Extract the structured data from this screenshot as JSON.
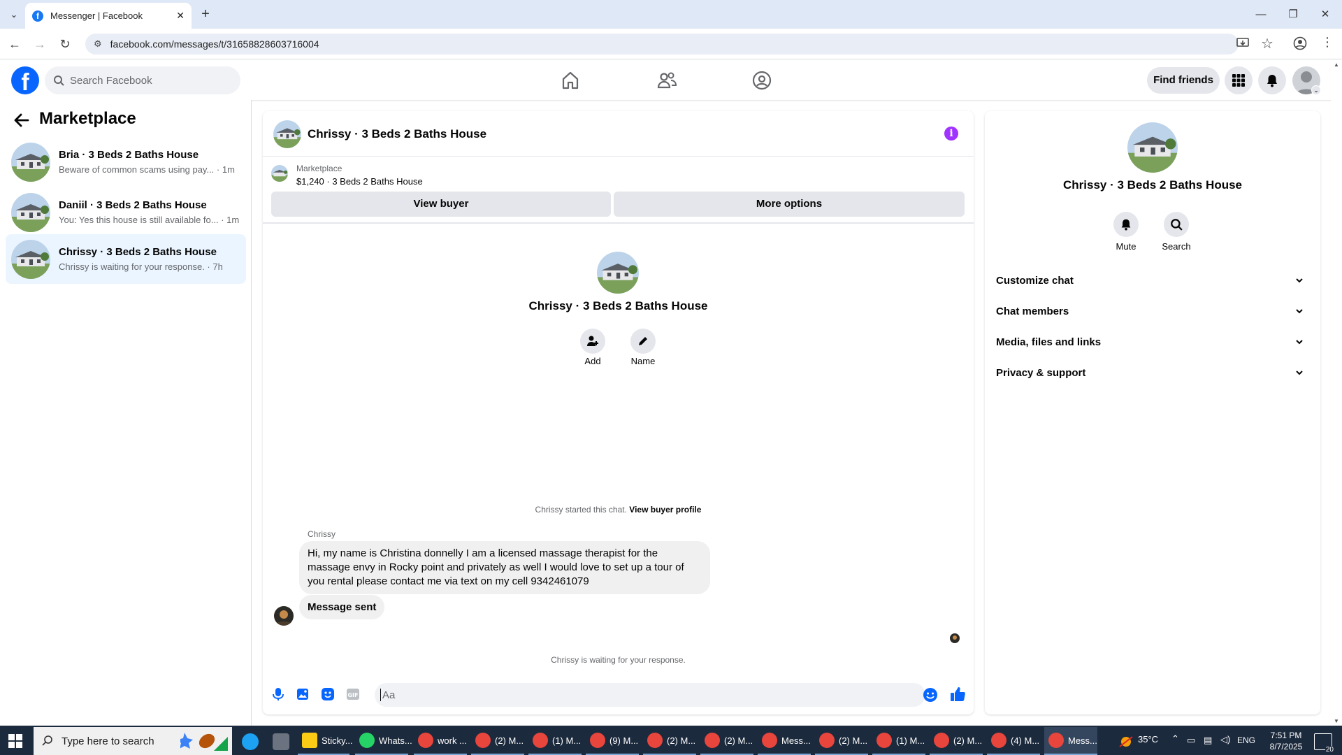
{
  "browser": {
    "tab_title": "Messenger | Facebook",
    "url": "facebook.com/messages/t/31658828603716004"
  },
  "header": {
    "search_placeholder": "Search Facebook",
    "find_friends": "Find friends"
  },
  "sidebar": {
    "title": "Marketplace",
    "conversations": [
      {
        "name": "Bria · 3 Beds 2 Baths House",
        "preview": "Beware of common scams using pay... · 1m",
        "active": false
      },
      {
        "name": "Daniil · 3 Beds 2 Baths House",
        "preview": "You: Yes this house is still available fo... · 1m",
        "active": false
      },
      {
        "name": "Chrissy · 3 Beds 2 Baths House",
        "preview": "Chrissy is waiting for your response. · 7h",
        "active": true
      }
    ]
  },
  "chat": {
    "title": "Chrissy · 3 Beds 2 Baths House",
    "marketplace_label": "Marketplace",
    "listing": "$1,240 · 3 Beds 2 Baths House",
    "view_buyer": "View buyer",
    "more_options": "More options",
    "center_name": "Chrissy · 3 Beds 2 Baths House",
    "add_label": "Add",
    "name_label": "Name",
    "started_text": "Chrissy started this chat.",
    "view_buyer_profile": "View buyer profile",
    "sender": "Chrissy",
    "message1": "Hi, my name is Christina donnelly I am a licensed massage therapist for the massage envy in Rocky point and privately as well I would love to set up a tour of you rental please contact me via text on my cell 9342461079",
    "message2": "Message sent",
    "waiting": "Chrissy is waiting for your response.",
    "input_placeholder": "Aa"
  },
  "details": {
    "name": "Chrissy · 3 Beds 2 Baths House",
    "mute": "Mute",
    "search": "Search",
    "sections": [
      "Customize chat",
      "Chat members",
      "Media, files and links",
      "Privacy & support"
    ]
  },
  "taskbar": {
    "search": "Type here to search",
    "items": [
      "Sticky...",
      "Whats...",
      "work ...",
      "(2) M...",
      "(1) M...",
      "(9) M...",
      "(2) M...",
      "(2) M...",
      "Mess...",
      "(2) M...",
      "(1) M...",
      "(2) M...",
      "(4) M...",
      "Mess..."
    ],
    "temperature": "35°C",
    "lang": "ENG",
    "time": "7:51 PM",
    "date": "8/7/2025",
    "notifications": "20"
  },
  "colors": {
    "brand": "#0866ff",
    "active_conversation": "#ebf5ff",
    "accent_purple": "#a033ff"
  }
}
